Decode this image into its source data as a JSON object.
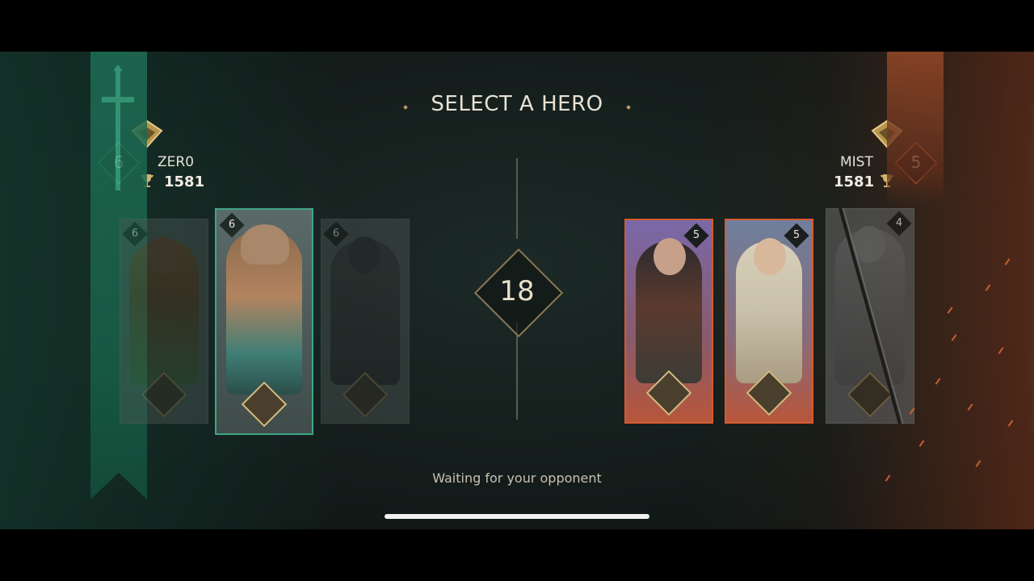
{
  "screen": {
    "title": "SELECT A HERO",
    "timer": "18",
    "status": "Waiting for your opponent"
  },
  "player": {
    "name": "ZER0",
    "trophies": "1581",
    "level": "6",
    "color": "#1f6e55"
  },
  "opponent": {
    "name": "MIST",
    "trophies": "1581",
    "level": "5",
    "color": "#8a3a22"
  },
  "player_cards": [
    {
      "level": "6",
      "state": "dimmed"
    },
    {
      "level": "6",
      "state": "selected"
    },
    {
      "level": "6",
      "state": "dimmed"
    }
  ],
  "opponent_cards": [
    {
      "level": "5",
      "state": "active"
    },
    {
      "level": "5",
      "state": "active"
    },
    {
      "level": "4",
      "state": "banned"
    }
  ],
  "icons": {
    "trophy": "trophy-icon",
    "rank": "rank-emblem-icon",
    "class": "hero-class-icon",
    "sword": "sword-icon"
  }
}
